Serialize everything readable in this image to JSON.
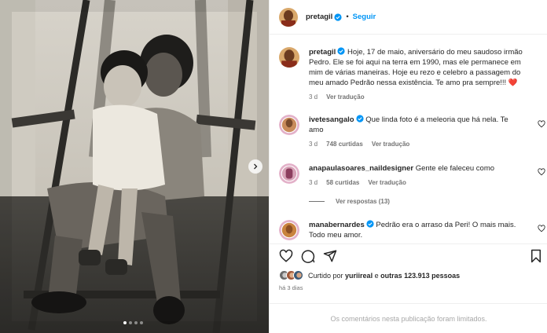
{
  "post": {
    "username": "pretagil",
    "follow_label": "Seguir",
    "separator": "•",
    "caption_text": "Hoje, 17 de maio, aniversário do meu saudoso irmão Pedro. Ele se foi aqui na terra em 1990, mas ele permanece em mim de várias maneiras. Hoje eu rezo e celebro a passagem do meu amado Pedrão nessa existência. Te amo pra sempre!!! ❤️",
    "caption_age": "3 d",
    "caption_translate": "Ver tradução",
    "carousel_total": 4,
    "carousel_active": 1
  },
  "comments": [
    {
      "username": "ivetesangalo",
      "verified": true,
      "text": "Que linda foto é a meleoria que há nela. Te amo",
      "age": "3 d",
      "likes": "748 curtidas",
      "translate": "Ver tradução"
    },
    {
      "username": "anapaulasoares_naildesigner",
      "verified": false,
      "text": "Gente ele faleceu como",
      "age": "3 d",
      "likes": "58 curtidas",
      "translate": "Ver tradução",
      "replies": "Ver respostas (13)"
    },
    {
      "username": "manabernardes",
      "verified": true,
      "text": "Pedrão era o arraso da Peri! O mais mais. Todo meu amor."
    }
  ],
  "likes_line": {
    "prefix": "Curtido por",
    "user": "yuriireal",
    "connector": "e",
    "others": "outras 123.913 pessoas"
  },
  "date": "há 3 dias",
  "comments_limited": "Os comentários nesta publicação foram limitados.",
  "colors": {
    "accent": "#0095f6",
    "heart": "#ed4956",
    "muted": "#737373"
  },
  "icons": [
    "verified-badge-icon",
    "heart-icon",
    "comment-icon",
    "share-icon",
    "bookmark-icon",
    "chevron-right-icon"
  ]
}
